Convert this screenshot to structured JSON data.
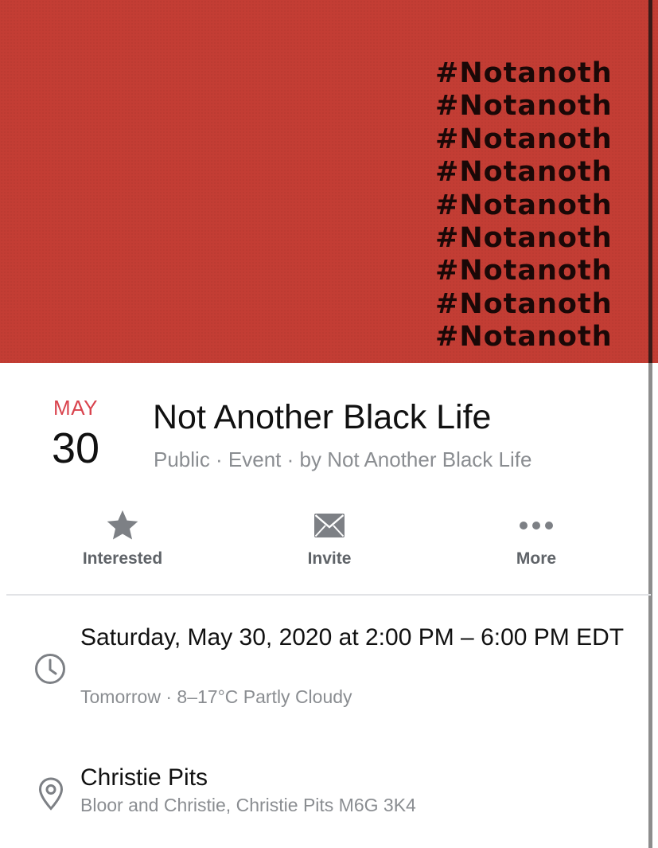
{
  "cover": {
    "hashtags": [
      "#Notanoth",
      "#Notanoth",
      "#Notanoth",
      "#Notanoth",
      "#Notanoth",
      "#Notanoth",
      "#Notanoth",
      "#Notanoth",
      "#Notanoth"
    ],
    "background_color": "#c33d34"
  },
  "event": {
    "month": "MAY",
    "day": "30",
    "title": "Not Another Black Life",
    "subtitle": "Public · Event · by Not Another Black Life"
  },
  "actions": [
    {
      "label": "Interested",
      "icon": "star-icon"
    },
    {
      "label": "Invite",
      "icon": "envelope-icon"
    },
    {
      "label": "More",
      "icon": "more-dots-icon"
    }
  ],
  "details": {
    "when": {
      "main": "Saturday, May 30, 2020 at 2:00 PM – 6:00 PM EDT",
      "sub": "Tomorrow · 8–17°C Partly Cloudy",
      "icon": "clock-icon"
    },
    "where": {
      "main": "Christie Pits",
      "sub": "Bloor and Christie, Christie Pits M6G 3K4",
      "icon": "location-pin-icon"
    }
  },
  "colors": {
    "accent_month": "#d9444e",
    "secondary_text": "#8a8d91",
    "icon_gray": "#7d8085"
  }
}
